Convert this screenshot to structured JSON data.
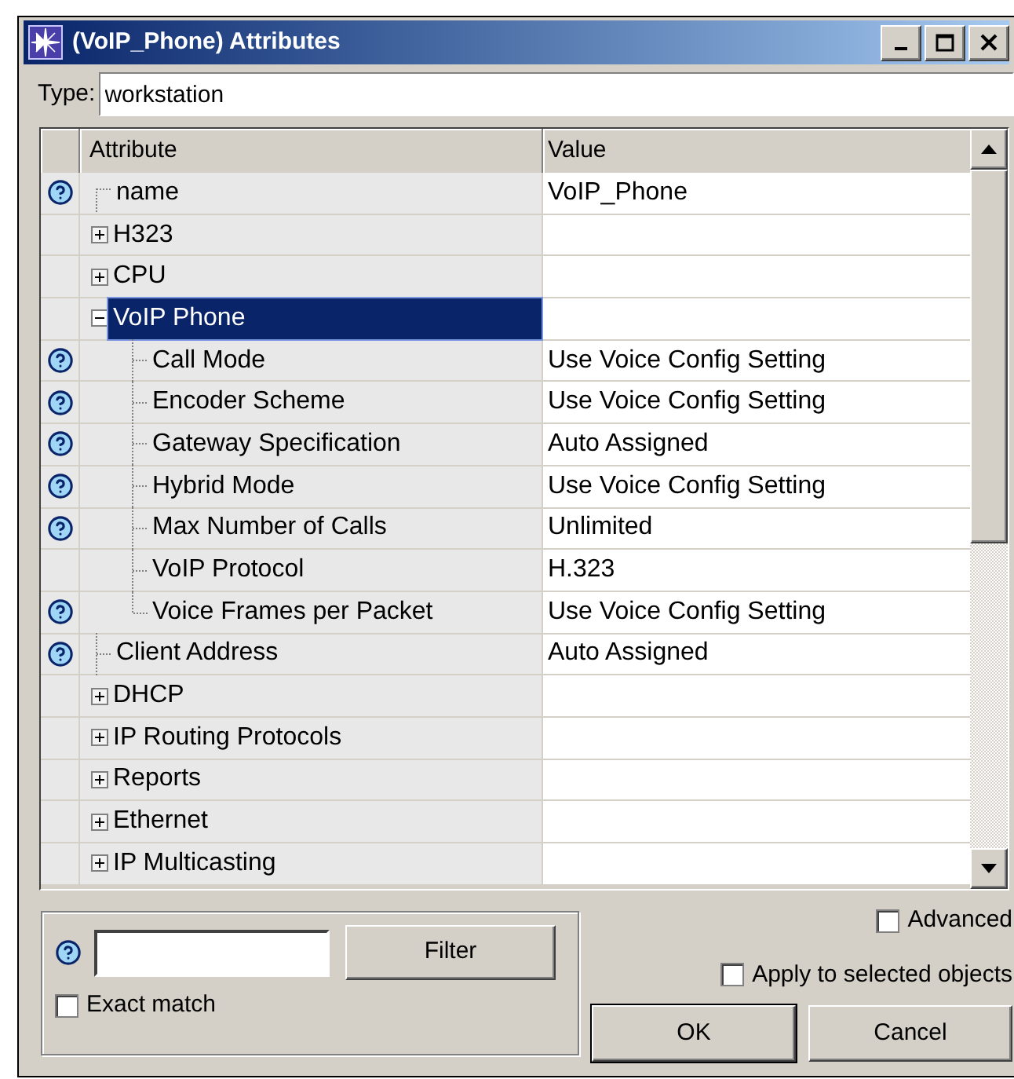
{
  "window": {
    "title": "(VoIP_Phone) Attributes"
  },
  "type_field": {
    "label": "Type:",
    "value": "workstation"
  },
  "table": {
    "columns": [
      "Attribute",
      "Value"
    ],
    "rows": [
      {
        "name": "name",
        "value": "VoIP_Phone",
        "help": true,
        "selected": false
      },
      {
        "name": "H323",
        "help": false,
        "expanded": false,
        "selected": false
      },
      {
        "name": "CPU",
        "help": false,
        "expanded": false,
        "selected": false
      },
      {
        "name": "VoIP Phone",
        "help": false,
        "expanded": true,
        "selected": true,
        "children": [
          {
            "name": "Call Mode",
            "value": "Use Voice Config Setting",
            "help": true,
            "selected": false
          },
          {
            "name": "Encoder Scheme",
            "value": "Use Voice Config Setting",
            "help": true,
            "selected": false
          },
          {
            "name": "Gateway Specification",
            "value": "Auto Assigned",
            "help": true,
            "selected": false
          },
          {
            "name": "Hybrid Mode",
            "value": "Use Voice Config Setting",
            "help": true,
            "selected": false
          },
          {
            "name": "Max Number of Calls",
            "value": "Unlimited",
            "help": true,
            "selected": false
          },
          {
            "name": "VoIP Protocol",
            "value": "H.323",
            "help": false,
            "selected": false
          },
          {
            "name": "Voice Frames per Packet",
            "value": "Use Voice Config Setting",
            "help": true,
            "selected": false
          }
        ]
      },
      {
        "name": "Client Address",
        "value": "Auto Assigned",
        "help": true,
        "selected": false
      },
      {
        "name": "DHCP",
        "help": false,
        "expanded": false,
        "selected": false
      },
      {
        "name": "IP Routing Protocols",
        "help": false,
        "expanded": false,
        "selected": false
      },
      {
        "name": "Reports",
        "help": false,
        "expanded": false,
        "selected": false
      },
      {
        "name": "Ethernet",
        "help": false,
        "expanded": false,
        "selected": false
      },
      {
        "name": "IP Multicasting",
        "help": false,
        "expanded": false,
        "selected": false
      }
    ]
  },
  "filter": {
    "button": "Filter",
    "exact_match": {
      "label": "Exact match",
      "checked": false
    }
  },
  "advanced": {
    "label": "Advanced",
    "checked": false
  },
  "apply_to_selected": {
    "label": "Apply to selected objects",
    "checked": false
  },
  "buttons": [
    "OK",
    "Cancel"
  ]
}
